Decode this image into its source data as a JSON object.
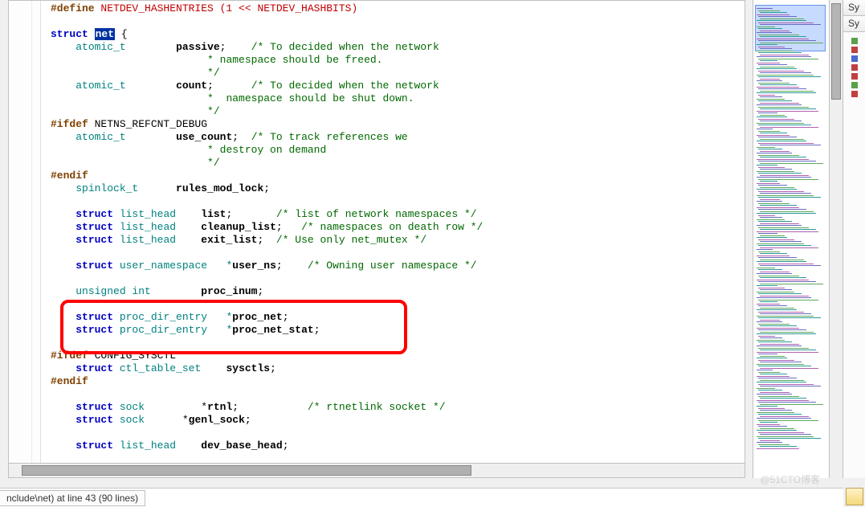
{
  "code": {
    "l1_pp": "#define",
    "l1_mac": " NETDEV_HASHENTRIES (1 << NETDEV_HASHBITS)",
    "l2_kw": "struct",
    "l2_sel": "net",
    "l2_brace": " {",
    "l3_type": "atomic_t",
    "l3_field": "passive",
    "l3_semi": ";",
    "l3_cmt": "/* To decided when the network",
    "l4_cmt": "* namespace should be freed.",
    "l5_cmt": "*/",
    "l6_type": "atomic_t",
    "l6_field": "count",
    "l6_semi": ";",
    "l6_cmt": "/* To decided when the network",
    "l7_cmt": "*  namespace should be shut down.",
    "l8_cmt": "*/",
    "l9_pp": "#ifdef",
    "l9_txt": " NETNS_REFCNT_DEBUG",
    "l10_type": "atomic_t",
    "l10_field": "use_count",
    "l10_semi": ";",
    "l10_cmt": "/* To track references we",
    "l11_cmt": "* destroy on demand",
    "l12_cmt": "*/",
    "l13_pp": "#endif",
    "l14_type": "spinlock_t",
    "l14_field": "rules_mod_lock",
    "l14_semi": ";",
    "l15_kw": "struct",
    "l15_type": " list_head",
    "l15_field": "list",
    "l15_semi": ";",
    "l15_cmt": "/* list of network namespaces */",
    "l16_kw": "struct",
    "l16_type": " list_head",
    "l16_field": "cleanup_list",
    "l16_semi": ";",
    "l16_cmt": "/* namespaces on death row */",
    "l17_kw": "struct",
    "l17_type": " list_head",
    "l17_field": "exit_list",
    "l17_semi": ";",
    "l17_cmt": "/* Use only net_mutex */",
    "l18_kw": "struct",
    "l18_type": " user_namespace   *",
    "l18_field": "user_ns",
    "l18_semi": ";",
    "l18_cmt": "/* Owning user namespace */",
    "l19_kw": "unsigned int",
    "l19_field": "proc_inum",
    "l19_semi": ";",
    "l20_kw": "struct",
    "l20_type": " proc_dir_entry   *",
    "l20_field": "proc_net",
    "l20_semi": ";",
    "l21_kw": "struct",
    "l21_type": " proc_dir_entry   *",
    "l21_field": "proc_net_stat",
    "l21_semi": ";",
    "l22_pp": "#ifdef",
    "l22_txt": " CONFIG_SYSCTL",
    "l23_kw": "struct",
    "l23_type": " ctl_table_set",
    "l23_field": "sysctls",
    "l23_semi": ";",
    "l24_pp": "#endif",
    "l25_kw": "struct",
    "l25_type": " sock",
    "l25_field": "rtnl",
    "l25_semi": ";",
    "l25_cmt": "/* rtnetlink socket */",
    "l26_kw": "struct",
    "l26_type": " sock",
    "l26_field": "genl_sock",
    "l26_semi": ";",
    "l27_kw": "struct",
    "l27_type": " list_head",
    "l27_field": "dev_base_head",
    "l27_semi": ";"
  },
  "status": {
    "text": "nclude\\net) at line 43 (90 lines)"
  },
  "right_panel": {
    "tab1": "Sy",
    "tab2": "Sy"
  },
  "watermark": "@51CTO博客"
}
